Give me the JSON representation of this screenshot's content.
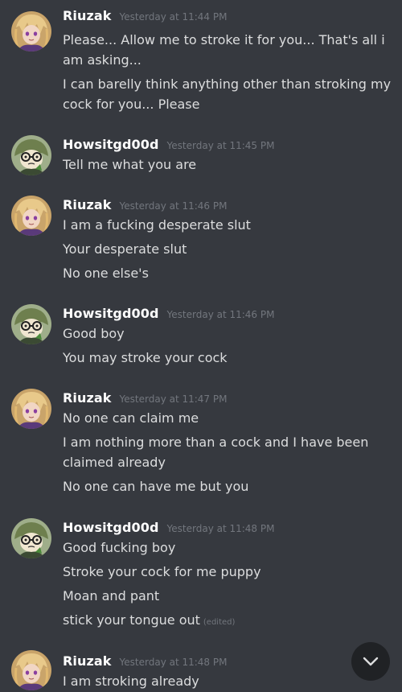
{
  "colors": {
    "background": "#36393f",
    "username": "#ffffff",
    "message_text": "#dcddde",
    "timestamp": "#72767d",
    "scroll_button": "#202225"
  },
  "groups": [
    {
      "username": "Riuzak",
      "timestamp": "Yesterday at 11:44 PM",
      "avatar": "riuzak-avatar",
      "lines": [
        "Please... Allow me to stroke it for you... That's all i am asking...",
        "I can barelly think anything other than stroking my cock for you... Please"
      ]
    },
    {
      "username": "Howsitgd00d",
      "timestamp": "Yesterday at 11:45 PM",
      "avatar": "howsitgd00d-avatar",
      "lines": [
        "Tell me what you are"
      ]
    },
    {
      "username": "Riuzak",
      "timestamp": "Yesterday at 11:46 PM",
      "avatar": "riuzak-avatar",
      "lines": [
        "I am a fucking desperate slut",
        "Your desperate slut",
        "No one else's"
      ]
    },
    {
      "username": "Howsitgd00d",
      "timestamp": "Yesterday at 11:46 PM",
      "avatar": "howsitgd00d-avatar",
      "lines": [
        "Good boy",
        "You may stroke your cock"
      ]
    },
    {
      "username": "Riuzak",
      "timestamp": "Yesterday at 11:47 PM",
      "avatar": "riuzak-avatar",
      "lines": [
        "No one can claim me",
        "I am nothing more than a cock and I have been claimed already",
        "No one can have me but you"
      ]
    },
    {
      "username": "Howsitgd00d",
      "timestamp": "Yesterday at 11:48 PM",
      "avatar": "howsitgd00d-avatar",
      "lines": [
        "Good fucking boy",
        "Stroke your cock for me puppy",
        "Moan and pant",
        "stick your tongue out"
      ],
      "edited_label": "(edited)"
    },
    {
      "username": "Riuzak",
      "timestamp": "Yesterday at 11:48 PM",
      "avatar": "riuzak-avatar",
      "lines": [
        "I am stroking already"
      ]
    }
  ],
  "scroll_button_icon": "chevron-down-icon"
}
